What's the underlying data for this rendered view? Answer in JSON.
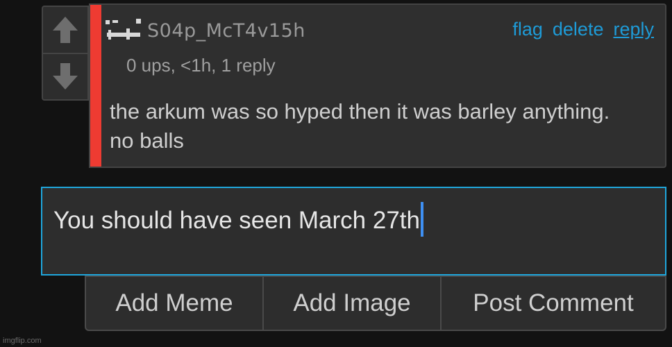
{
  "comment": {
    "username": "S04p_McT4v15h",
    "meta": "0 ups, <1h, 1 reply",
    "body": "the arkum was so hyped then it was barley anything. no balls",
    "actions": {
      "flag": "flag",
      "delete": "delete",
      "reply": "reply"
    },
    "op_bar_color": "#ee3b32",
    "vote_icons": [
      "arrow-up-icon",
      "arrow-down-icon"
    ]
  },
  "reply_box": {
    "value": "You should have seen March 27th",
    "focus_color": "#1fa7dd"
  },
  "buttons": {
    "add_meme": "Add Meme",
    "add_image": "Add Image",
    "post_comment": "Post Comment"
  },
  "watermark": "imgflip.com"
}
